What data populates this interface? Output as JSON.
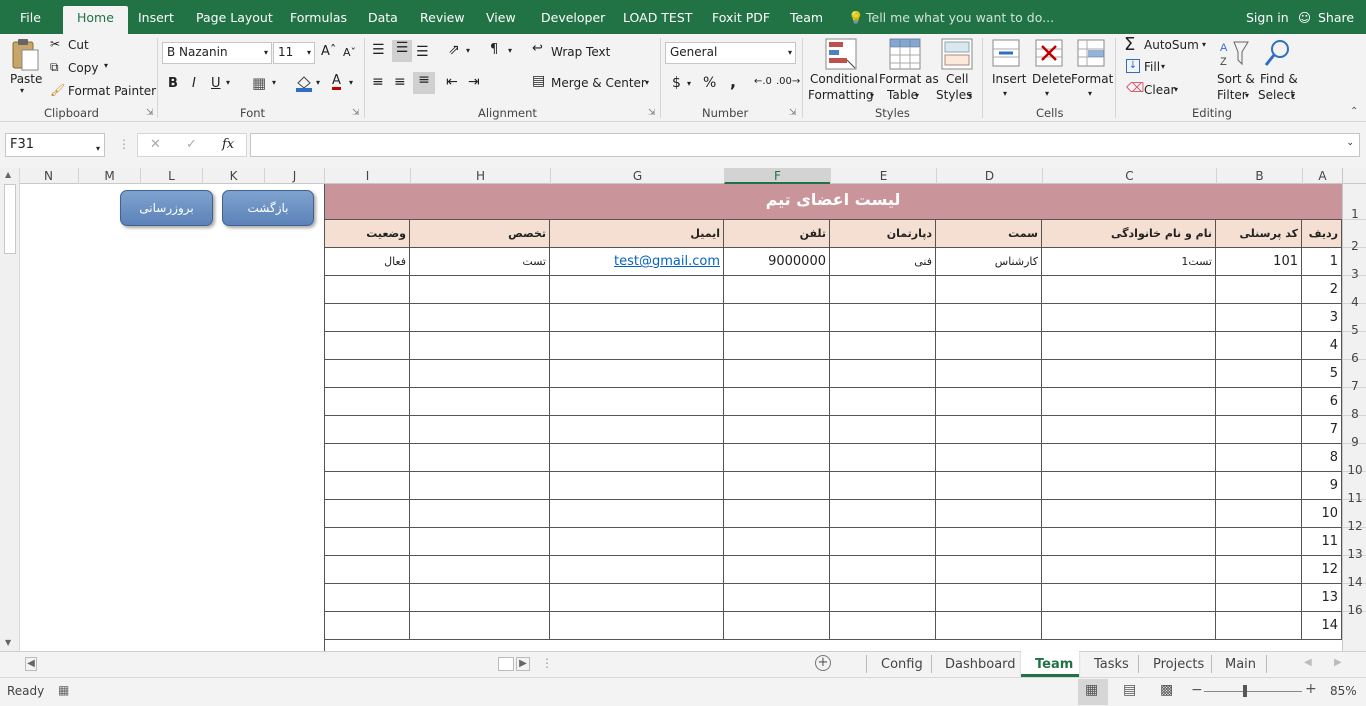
{
  "tabs": {
    "items": [
      "File",
      "Home",
      "Insert",
      "Page Layout",
      "Formulas",
      "Data",
      "Review",
      "View",
      "Developer",
      "LOAD TEST",
      "Foxit PDF",
      "Team"
    ],
    "active": "Home",
    "tell_me": "Tell me what you want to do...",
    "sign_in": "Sign in",
    "share": "Share"
  },
  "ribbon": {
    "clipboard": {
      "label": "Clipboard",
      "paste": "Paste",
      "cut": "Cut",
      "copy": "Copy",
      "format_painter": "Format Painter"
    },
    "font": {
      "label": "Font",
      "name": "B Nazanin",
      "size": "11",
      "bold": "B",
      "italic": "I",
      "underline": "U"
    },
    "alignment": {
      "label": "Alignment",
      "wrap_text": "Wrap Text",
      "merge_center": "Merge & Center"
    },
    "number": {
      "label": "Number",
      "format": "General",
      "currency": "$",
      "percent": "%",
      "comma": ","
    },
    "styles": {
      "label": "Styles",
      "conditional_1": "Conditional",
      "conditional_2": "Formatting",
      "format_table_1": "Format as",
      "format_table_2": "Table",
      "cell_styles_1": "Cell",
      "cell_styles_2": "Styles"
    },
    "cells": {
      "label": "Cells",
      "insert": "Insert",
      "delete": "Delete",
      "format": "Format"
    },
    "editing": {
      "label": "Editing",
      "autosum": "AutoSum",
      "fill": "Fill",
      "clear": "Clear",
      "sort_1": "Sort &",
      "sort_2": "Filter",
      "find_1": "Find &",
      "find_2": "Select"
    }
  },
  "formula_bar": {
    "name_box": "F31",
    "fx": "fx",
    "value": ""
  },
  "columns": [
    {
      "id": "A",
      "w": 40
    },
    {
      "id": "B",
      "w": 86
    },
    {
      "id": "C",
      "w": 174
    },
    {
      "id": "D",
      "w": 106
    },
    {
      "id": "E",
      "w": 106
    },
    {
      "id": "F",
      "w": 106
    },
    {
      "id": "G",
      "w": 174
    },
    {
      "id": "H",
      "w": 140
    },
    {
      "id": "I",
      "w": 86
    },
    {
      "id": "J",
      "w": 60
    },
    {
      "id": "K",
      "w": 62
    },
    {
      "id": "L",
      "w": 62
    },
    {
      "id": "M",
      "w": 62
    },
    {
      "id": "N",
      "w": 60
    }
  ],
  "rows": [
    "1",
    "2",
    "3",
    "4",
    "5",
    "6",
    "7",
    "8",
    "9",
    "10",
    "11",
    "12",
    "13",
    "14",
    "16"
  ],
  "sheet": {
    "title": "لیست اعضای تیم",
    "headers": [
      "ردیف",
      "کد پرسنلی",
      "نام و نام خانوادگی",
      "سمت",
      "دپارتمان",
      "تلفن",
      "ایمیل",
      "تخصص",
      "وضعیت"
    ],
    "data_row": [
      "1",
      "101",
      "تست1",
      "کارشناس",
      "فنی",
      "9000000",
      "test@gmail.com",
      "تست",
      "فعال"
    ],
    "row_numbers": [
      "2",
      "3",
      "4",
      "5",
      "6",
      "7",
      "8",
      "9",
      "10",
      "11",
      "12",
      "13",
      "14"
    ]
  },
  "buttons": {
    "back": "بازگشت",
    "update": "بروزرسانی"
  },
  "sheet_tabs": {
    "items": [
      "Config",
      "Dashboard",
      "Team",
      "Tasks",
      "Projects",
      "Main"
    ],
    "active": "Team"
  },
  "status": {
    "ready": "Ready",
    "zoom": "85%"
  },
  "colors": {
    "title_bg": "#c9959a",
    "header_bg": "#f4dfd2",
    "accent": "#217346",
    "link": "#0563c1"
  }
}
